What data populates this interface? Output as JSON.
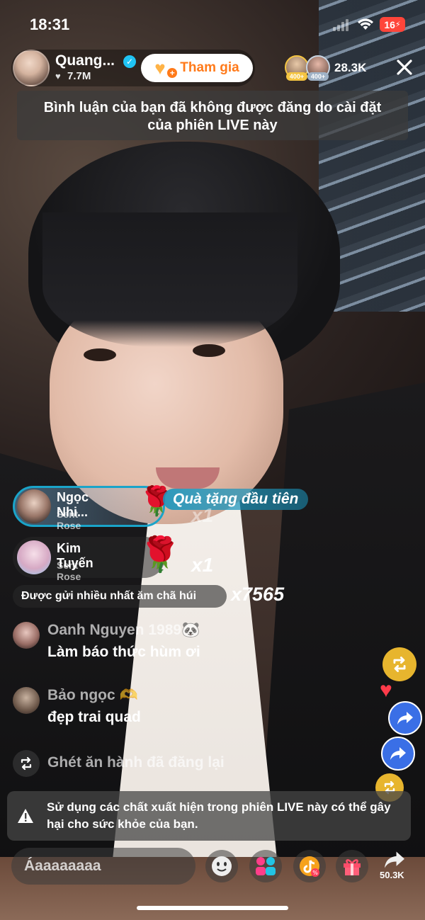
{
  "status_bar": {
    "time": "18:31",
    "battery": "16"
  },
  "host": {
    "name": "Quang...",
    "likes": "7.7M",
    "join_label": "Tham gia"
  },
  "viewers": {
    "badge_1": "400+",
    "badge_2": "400+",
    "count": "28.3K"
  },
  "notice": {
    "text": "Bình luận của bạn đã không được đăng do cài đặt của phiên LIVE này"
  },
  "gifts": [
    {
      "user": "Ngọc Nhi...",
      "action": "Sent Rose",
      "count": "x1",
      "banner": "Quà tặng đầu tiên"
    },
    {
      "user": "Kim Tuyến",
      "action": "Sent Rose",
      "count": "x1"
    }
  ],
  "top_gift": {
    "label": "Được gửi nhiều nhất ăm chã húi",
    "count": "x7565"
  },
  "comments": [
    {
      "user": "Oanh Nguyen 1989🐼",
      "text": "Làm báo thức hùm ơi"
    },
    {
      "user": "Bảo ngọc 🫶",
      "text": "đẹp trai quad"
    },
    {
      "user": "Ghét ăn hành",
      "text": "đã đăng lại"
    }
  ],
  "warning": {
    "text": "Sử dụng các chất xuất hiện trong phiên LIVE này có thể gây hại cho sức khỏe của bạn."
  },
  "bottom_bar": {
    "input_value": "Áaaaaaaaa",
    "share_count": "50.3K"
  },
  "colors": {
    "accent_orange": "#ff7a1a",
    "verified_blue": "#20c4f4",
    "gift_teal": "#1aa4c9",
    "battery_red": "#ff453a",
    "gold": "#e7b52e"
  },
  "icons": {
    "close": "close-icon",
    "verified": "verified-icon",
    "rose": "rose-icon",
    "repost": "repost-icon",
    "warning": "warning-icon",
    "emoji": "emoji-icon",
    "guests": "guests-icon",
    "tiktok_shop": "tiktok-shop-icon",
    "gift": "gift-icon",
    "share": "share-icon"
  }
}
